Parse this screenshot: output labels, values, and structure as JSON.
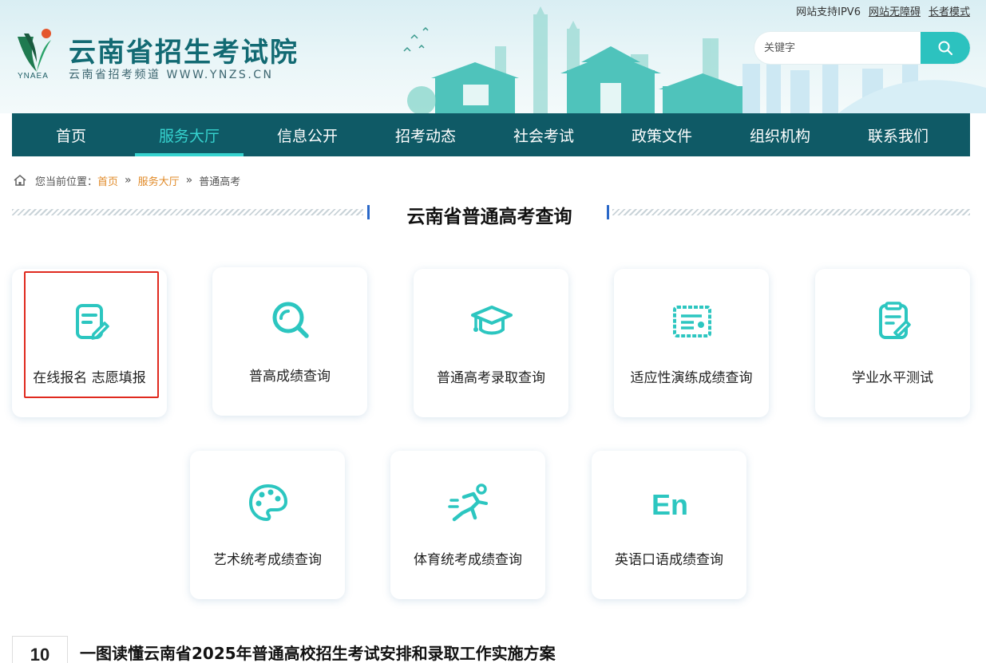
{
  "header": {
    "site_title": "云南省招生考试院",
    "site_subtitle": "云南省招考频道 WWW.YNZS.CN",
    "logo_abbr": "YNAEA",
    "top_links": [
      "网站支持IPV6",
      "网站无障碍",
      "长者模式"
    ],
    "search_placeholder": "关键字"
  },
  "nav": {
    "items": [
      {
        "label": "首页"
      },
      {
        "label": "服务大厅"
      },
      {
        "label": "信息公开"
      },
      {
        "label": "招考动态"
      },
      {
        "label": "社会考试"
      },
      {
        "label": "政策文件"
      },
      {
        "label": "组织机构"
      },
      {
        "label": "联系我们"
      }
    ],
    "active_label": "服务大厅"
  },
  "breadcrumb": {
    "prefix": "您当前位置：",
    "items": [
      "首页",
      "服务大厅",
      "普通高考"
    ]
  },
  "section": {
    "title": "云南省普通高考查询"
  },
  "cards": [
    {
      "label": "在线报名 志愿填报",
      "icon": "form-edit-icon"
    },
    {
      "label": "普高成绩查询",
      "icon": "search-icon"
    },
    {
      "label": "普通高考录取查询",
      "icon": "graduation-cap-icon"
    },
    {
      "label": "适应性演练成绩查询",
      "icon": "certificate-icon"
    },
    {
      "label": "学业水平测试",
      "icon": "document-check-icon"
    },
    {
      "label": "艺术统考成绩查询",
      "icon": "palette-icon"
    },
    {
      "label": "体育统考成绩查询",
      "icon": "runner-icon"
    },
    {
      "label": "英语口语成绩查询",
      "icon": "en-text-icon",
      "icon_text": "En"
    }
  ],
  "news": {
    "date_day": "10",
    "title": "一图读懂云南省2025年普通高校招生考试安排和录取工作实施方案"
  },
  "colors": {
    "nav_bg": "#0f5a66",
    "accent": "#36d3cf",
    "icon": "#2cc6c0",
    "breadcrumb_link": "#e18b2a",
    "highlight": "#e02a1f"
  }
}
